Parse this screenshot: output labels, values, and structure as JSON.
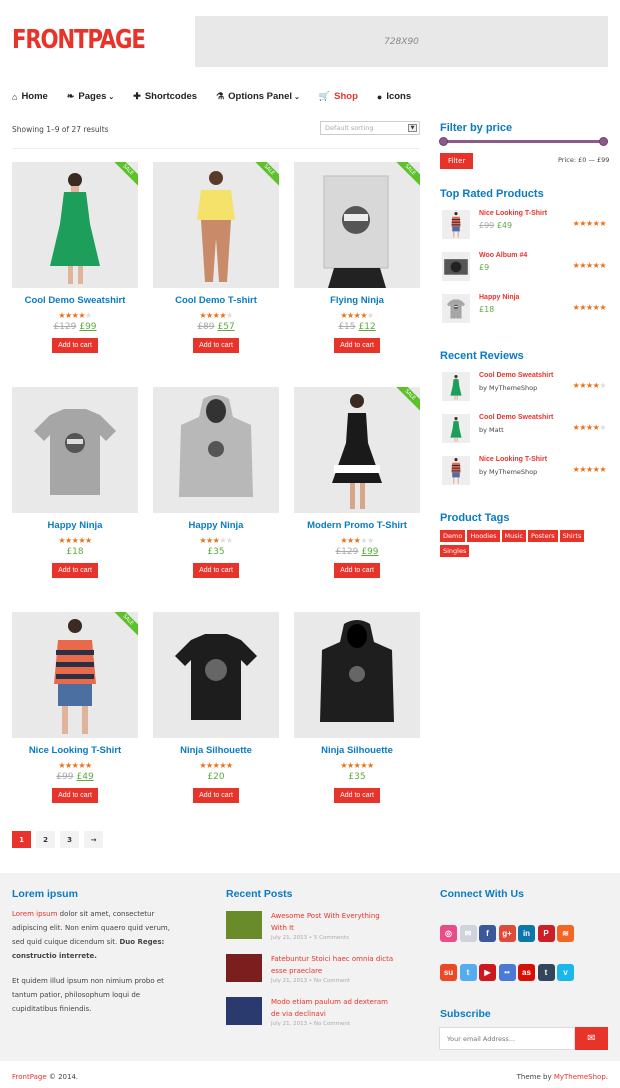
{
  "site": {
    "logo": "FRONTPAGE",
    "banner": "728X90"
  },
  "nav": [
    {
      "icon": "home-icon",
      "glyph": "⌂",
      "label": "Home",
      "caret": false,
      "active": false
    },
    {
      "icon": "leaf-icon",
      "glyph": "❧",
      "label": "Pages",
      "caret": true,
      "active": false
    },
    {
      "icon": "plus-icon",
      "glyph": "✚",
      "label": "Shortcodes",
      "caret": false,
      "active": false
    },
    {
      "icon": "flask-icon",
      "glyph": "⚗",
      "label": "Options Panel",
      "caret": true,
      "active": false
    },
    {
      "icon": "cart-icon",
      "glyph": "🛒",
      "label": "Shop",
      "caret": false,
      "active": true
    },
    {
      "icon": "apple-icon",
      "glyph": "●",
      "label": "Icons",
      "caret": false,
      "active": false
    }
  ],
  "shop": {
    "results": "Showing 1–9 of 27 results",
    "sort": "Default sorting",
    "add_to_cart": "Add to cart",
    "pages": [
      "1",
      "2",
      "3",
      "→"
    ]
  },
  "products": [
    {
      "title": "Cool Demo Sweatshirt",
      "old": "£129",
      "price": "£99",
      "rating": 4,
      "sale": true,
      "img": "dress-green",
      "sale_label": "SALE"
    },
    {
      "title": "Cool Demo T-shirt",
      "old": "£89",
      "price": "£57",
      "rating": 4,
      "sale": true,
      "img": "yellow-top",
      "sale_label": "SALE"
    },
    {
      "title": "Flying Ninja",
      "old": "£15",
      "price": "£12",
      "rating": 4,
      "sale": true,
      "img": "poster",
      "sale_label": "SALE"
    },
    {
      "title": "Happy Ninja",
      "old": "",
      "price": "£18",
      "rating": 5,
      "sale": false,
      "img": "tee-grey",
      "sale_label": ""
    },
    {
      "title": "Happy Ninja",
      "old": "",
      "price": "£35",
      "rating": 3,
      "sale": false,
      "img": "hoodie-grey",
      "sale_label": ""
    },
    {
      "title": "Modern Promo T-Shirt",
      "old": "£129",
      "price": "£99",
      "rating": 3,
      "sale": true,
      "img": "dress-black",
      "sale_label": "SALE"
    },
    {
      "title": "Nice Looking T-Shirt",
      "old": "£99",
      "price": "£49",
      "rating": 5,
      "sale": true,
      "img": "stripes",
      "sale_label": "SALE"
    },
    {
      "title": "Ninja Silhouette",
      "old": "",
      "price": "£20",
      "rating": 5,
      "sale": false,
      "img": "tee-black",
      "sale_label": ""
    },
    {
      "title": "Ninja Silhouette",
      "old": "",
      "price": "£35",
      "rating": 4.5,
      "sale": false,
      "img": "hoodie-black",
      "sale_label": ""
    }
  ],
  "sidebar": {
    "filter_title": "Filter by price",
    "filter_btn": "Filter",
    "price_range": "Price: £0 — £99",
    "top_rated_title": "Top Rated Products",
    "top_rated": [
      {
        "name": "Nice Looking T-Shirt",
        "old": "£99",
        "price": "£49",
        "rating": 5,
        "img": "stripes"
      },
      {
        "name": "Woo Album #4",
        "old": "",
        "price": "£9",
        "rating": 5,
        "img": "album"
      },
      {
        "name": "Happy Ninja",
        "old": "",
        "price": "£18",
        "rating": 5,
        "img": "tee-grey"
      }
    ],
    "reviews_title": "Recent Reviews",
    "reviews": [
      {
        "name": "Cool Demo Sweatshirt",
        "by": "by MyThemeShop",
        "rating": 4,
        "img": "dress-green"
      },
      {
        "name": "Cool Demo Sweatshirt",
        "by": "by Matt",
        "rating": 4,
        "img": "dress-green"
      },
      {
        "name": "Nice Looking T-Shirt",
        "by": "by MyThemeShop",
        "rating": 5,
        "img": "stripes"
      }
    ],
    "tags_title": "Product Tags",
    "tags": [
      "Demo",
      "Hoodies",
      "Music",
      "Posters",
      "Shirts",
      "Singles"
    ]
  },
  "footer": {
    "col1_title": "Lorem ipsum",
    "col1_p1_red": "Lorem ipsum",
    "col1_p1_text": " dolor sit amet, consectetur adipiscing elit. Non enim quaero quid verum, sed quid cuique dicendum sit. ",
    "col1_p1_bold": "Duo Reges: constructio interrete.",
    "col1_p2": "Et quidem illud ipsum non nimium probo et tantum patior, philosophum loqui de cupiditatibus finiendis.",
    "col2_title": "Recent Posts",
    "posts": [
      {
        "title": "Awesome Post With Everything With It",
        "meta": "July 21, 2013 • 5 Comments"
      },
      {
        "title": "Fatebuntur Stoici haec omnia dicta esse praeclare",
        "meta": "July 21, 2013 • No Comment"
      },
      {
        "title": "Modo etiam paulum ad dexteram de via declinavi",
        "meta": "July 21, 2013 • No Comment"
      }
    ],
    "col3_title": "Connect With Us",
    "social_row1": [
      {
        "name": "dribbble-icon",
        "glyph": "◎",
        "color": "#ea4c89"
      },
      {
        "name": "mail-icon",
        "glyph": "✉",
        "color": "#cfd4dc"
      },
      {
        "name": "facebook-icon",
        "glyph": "f",
        "color": "#3b5998"
      },
      {
        "name": "google-plus-icon",
        "glyph": "g+",
        "color": "#dd4b39"
      },
      {
        "name": "linkedin-icon",
        "glyph": "in",
        "color": "#0e76a8"
      },
      {
        "name": "pinterest-icon",
        "glyph": "P",
        "color": "#cb2027"
      },
      {
        "name": "rss-icon",
        "glyph": "≋",
        "color": "#f26522"
      }
    ],
    "social_row2": [
      {
        "name": "stumbleupon-icon",
        "glyph": "su",
        "color": "#eb4924"
      },
      {
        "name": "twitter-icon",
        "glyph": "t",
        "color": "#55acee"
      },
      {
        "name": "youtube-icon",
        "glyph": "▶",
        "color": "#cc181e"
      },
      {
        "name": "flickr-icon",
        "glyph": "••",
        "color": "#4b7ad6"
      },
      {
        "name": "lastfm-icon",
        "glyph": "as",
        "color": "#d51007"
      },
      {
        "name": "tumblr-icon",
        "glyph": "t",
        "color": "#35465c"
      },
      {
        "name": "vimeo-icon",
        "glyph": "v",
        "color": "#1ab7ea"
      }
    ],
    "subscribe_title": "Subscribe",
    "subscribe_placeholder": "Your email Address...",
    "subscribe_btn_icon": "✉"
  },
  "bottom": {
    "left_link": "FrontPage",
    "left_text": " © 2014.",
    "right_text": "Theme by ",
    "right_link": "MyThemeShop",
    "right_end": "."
  },
  "colors": {
    "accent": "#e8332a",
    "link": "#0a7bc2",
    "price": "#5dab3f",
    "star": "#e8721a",
    "sale": "#5dc12a"
  }
}
